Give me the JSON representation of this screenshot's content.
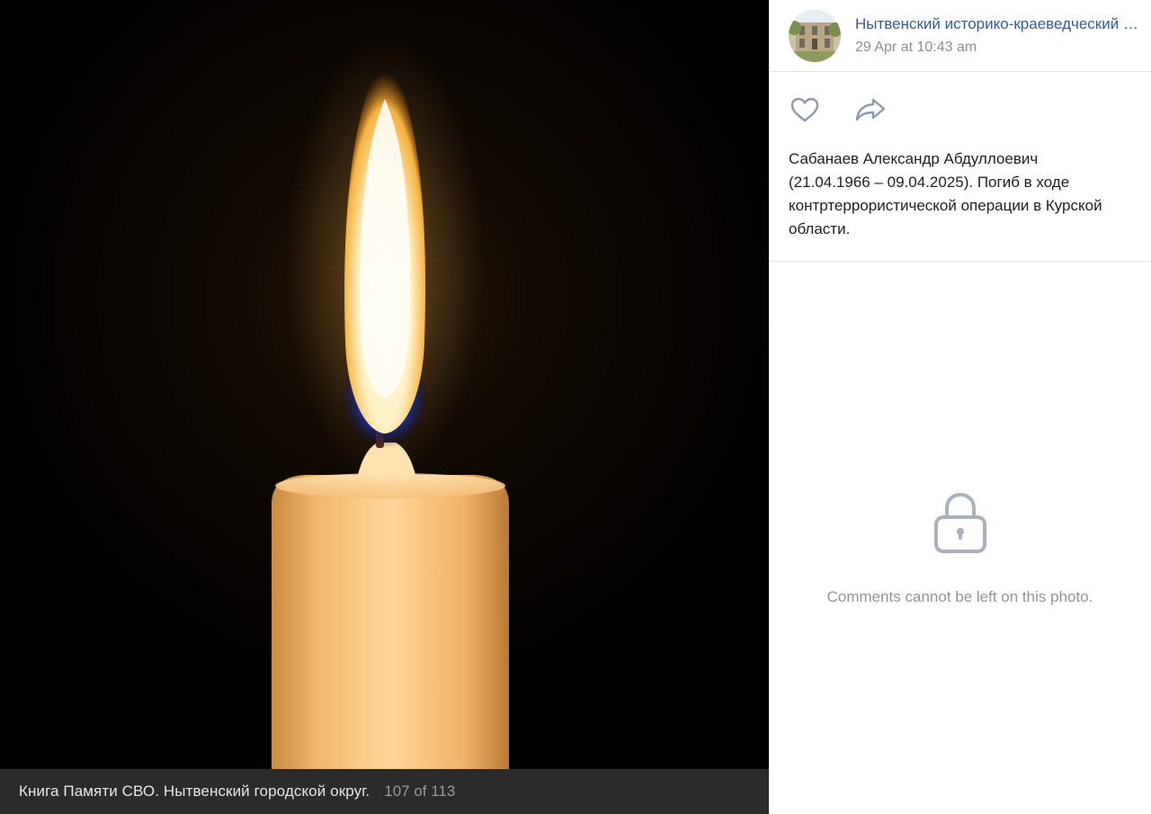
{
  "photo": {
    "description": "candle-flame-photo"
  },
  "caption": {
    "album_title": "Книга Памяти СВО. Нытвенский городской округ.",
    "counter": "107 of 113"
  },
  "post": {
    "group_name": "Нытвенский историко-краеведческий музей",
    "date": "29 Apr at 10:43 am",
    "text_lines": [
      "Сабанаев Александр Абдуллоевич",
      "(21.04.1966 – 09.04.2025). Погиб в ходе",
      "контртеррористической операции в Курской",
      "области."
    ]
  },
  "actions": {
    "like_icon": "heart-icon",
    "share_icon": "share-arrow-icon"
  },
  "comments": {
    "icon": "lock-icon",
    "message": "Comments cannot be left on this photo."
  },
  "colors": {
    "link": "#2f5f94",
    "muted": "#8a8f96",
    "icon": "#8d9aab",
    "caption_bg": "#2b2b2b"
  }
}
